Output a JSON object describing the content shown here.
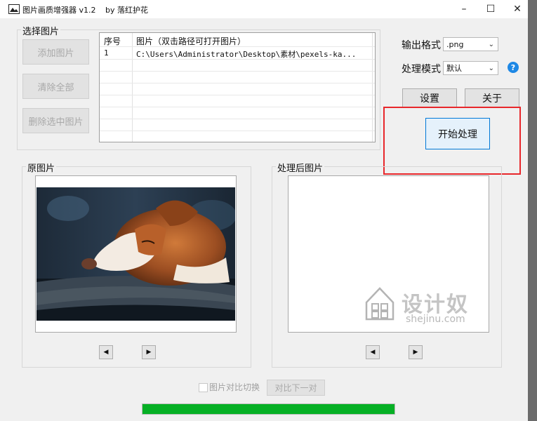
{
  "window": {
    "title": "图片画质增强器 v1.2",
    "by": "by 落红护花",
    "minimize_glyph": "–",
    "maximize_glyph": "☐",
    "close_glyph": "✕"
  },
  "select_group": {
    "label": "选择图片",
    "add_button": "添加图片",
    "clear_button": "清除全部",
    "delete_button": "删除选中图片"
  },
  "file_list": {
    "columns": [
      "序号",
      "图片（双击路径可打开图片）"
    ],
    "rows": [
      {
        "index": "1",
        "path": "C:\\Users\\Administrator\\Desktop\\素材\\pexels-ka..."
      }
    ]
  },
  "output": {
    "format_label": "输出格式",
    "format_value": ".png",
    "mode_label": "处理模式",
    "mode_value": "默认",
    "help_glyph": "?"
  },
  "actions": {
    "settings": "设置",
    "about": "关于",
    "start": "开始处理"
  },
  "original": {
    "label": "原图片",
    "prev_glyph": "◀",
    "next_glyph": "▶"
  },
  "processed": {
    "label": "处理后图片",
    "prev_glyph": "◀",
    "next_glyph": "▶",
    "watermark_title": "设计奴",
    "watermark_url": "shejinu.com"
  },
  "compare": {
    "toggle_label": "图片对比切换",
    "next_pair": "对比下一对"
  },
  "progress": {
    "value_percent": 100
  },
  "colors": {
    "progress": "#06b025",
    "highlight": "#e8272b",
    "help": "#1e88e5"
  }
}
